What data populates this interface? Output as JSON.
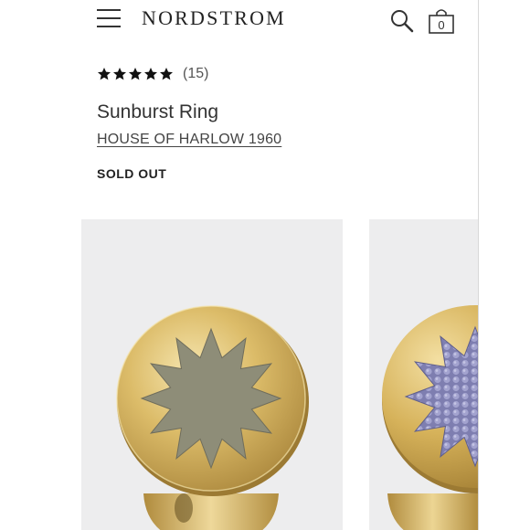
{
  "header": {
    "logo_text": "NORDSTROM",
    "bag_count": "0",
    "icons": [
      "hamburger-menu-icon",
      "search-icon",
      "shopping-bag-icon"
    ]
  },
  "product": {
    "rating": 5,
    "review_count": "(15)",
    "title": "Sunburst Ring",
    "brand": "HOUSE OF HARLOW 1960",
    "status": "SOLD OUT"
  },
  "gallery": {
    "images": [
      {
        "subject": "gold sunburst ring with olive grey leather inlay"
      },
      {
        "subject": "gold sunburst ring with lavender stingray inlay"
      }
    ]
  },
  "colors": {
    "tile_background": "#ededee",
    "gold": "#d6b25a",
    "olive_leather": "#8e8d78",
    "lavender_stingray": "#8f8fbf"
  }
}
